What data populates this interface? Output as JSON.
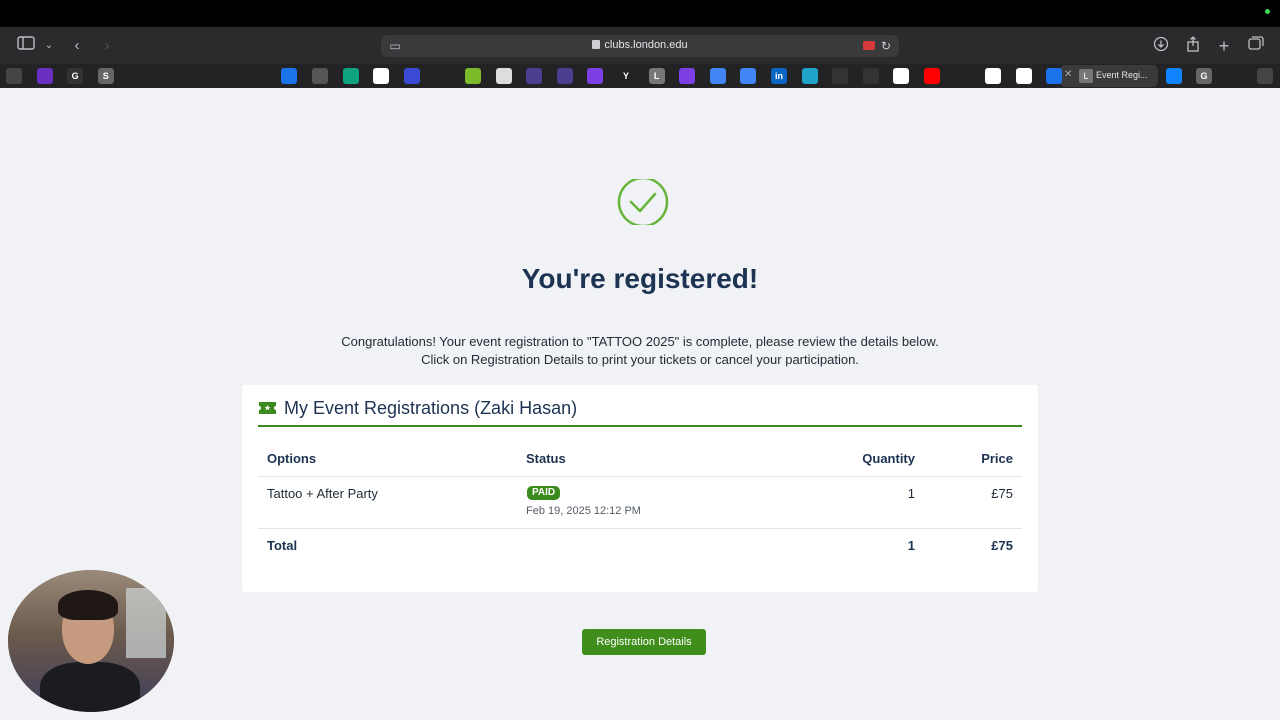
{
  "browser": {
    "url": "clubs.london.edu",
    "active_tab_title": "Event Regi...",
    "active_tab_icon_letter": "L"
  },
  "tabs": [
    {
      "icon": "openai-icon",
      "color": "#444"
    },
    {
      "icon": "yahoo-icon",
      "color": "#6b2fbf"
    },
    {
      "icon": "g-letter-icon",
      "color": "#333",
      "letter": "G"
    },
    {
      "icon": "s-letter-icon",
      "color": "#666",
      "letter": "S"
    },
    {
      "icon": "dark-app-icon",
      "color": "#222"
    },
    {
      "icon": "dark-app-icon",
      "color": "#222"
    },
    {
      "icon": "dark-app-icon",
      "color": "#222"
    },
    {
      "icon": "dark-app-icon",
      "color": "#222"
    },
    {
      "icon": "dark-app-icon",
      "color": "#222"
    },
    {
      "icon": "calendar-icon",
      "color": "#1a73e8"
    },
    {
      "icon": "cube-icon",
      "color": "#555"
    },
    {
      "icon": "chatgpt-icon",
      "color": "#10a37f"
    },
    {
      "icon": "google-icon",
      "color": "#fff"
    },
    {
      "icon": "bars-icon",
      "color": "#3b4bd6"
    },
    {
      "icon": "ro-icon",
      "color": "#222"
    },
    {
      "icon": "leaf-icon",
      "color": "#7cbb2a"
    },
    {
      "icon": "mail-icon",
      "color": "#ddd"
    },
    {
      "icon": "square-icon",
      "color": "#4a3f8f"
    },
    {
      "icon": "square-icon",
      "color": "#4a3f8f"
    },
    {
      "icon": "ring-icon",
      "color": "#7b3fe4"
    },
    {
      "icon": "y-letter-icon",
      "color": "#222",
      "letter": "Y"
    },
    {
      "icon": "l-letter-icon",
      "color": "#777",
      "letter": "L"
    },
    {
      "icon": "ring-icon",
      "color": "#7b3fe4"
    },
    {
      "icon": "docs-icon",
      "color": "#4285f4"
    },
    {
      "icon": "docs-icon",
      "color": "#4285f4"
    },
    {
      "icon": "linkedin-icon",
      "color": "#0a66c2",
      "letter": "in"
    },
    {
      "icon": "cloud-icon",
      "color": "#1fa3c8"
    },
    {
      "icon": "chart-icon",
      "color": "#333"
    },
    {
      "icon": "chart-icon",
      "color": "#333"
    },
    {
      "icon": "google-icon",
      "color": "#fff"
    },
    {
      "icon": "youtube-icon",
      "color": "#ff0000"
    },
    {
      "icon": "github-icon",
      "color": "#222"
    },
    {
      "icon": "google-icon",
      "color": "#fff"
    },
    {
      "icon": "google-icon",
      "color": "#fff"
    },
    {
      "icon": "chrome-icon",
      "color": "#1a73e8"
    }
  ],
  "tabs_after": [
    {
      "icon": "butterfly-icon",
      "color": "#1185fe"
    },
    {
      "icon": "g-letter-icon",
      "color": "#666",
      "letter": "G"
    },
    {
      "icon": "heart-icon",
      "color": "#222"
    },
    {
      "icon": "openai-icon",
      "color": "#444"
    }
  ],
  "page": {
    "heading": "You're registered!",
    "message_line1": "Congratulations! Your event registration to \"TATTOO 2025\" is complete, please review the details below.",
    "message_line2": "Click on Registration Details to print your tickets or cancel your participation.",
    "card_title": "My Event Registrations (Zaki Hasan)",
    "table": {
      "headers": {
        "options": "Options",
        "status": "Status",
        "quantity": "Quantity",
        "price": "Price"
      },
      "row": {
        "option": "Tattoo + After Party",
        "status": "PAID",
        "date": "Feb 19, 2025 12:12 PM",
        "quantity": "1",
        "price": "£75"
      },
      "total": {
        "label": "Total",
        "quantity": "1",
        "price": "£75"
      }
    },
    "button_label": "Registration Details"
  },
  "colors": {
    "accent_green": "#3f8d1b",
    "heading_navy": "#1d3352",
    "check_green": "#66b53a"
  }
}
